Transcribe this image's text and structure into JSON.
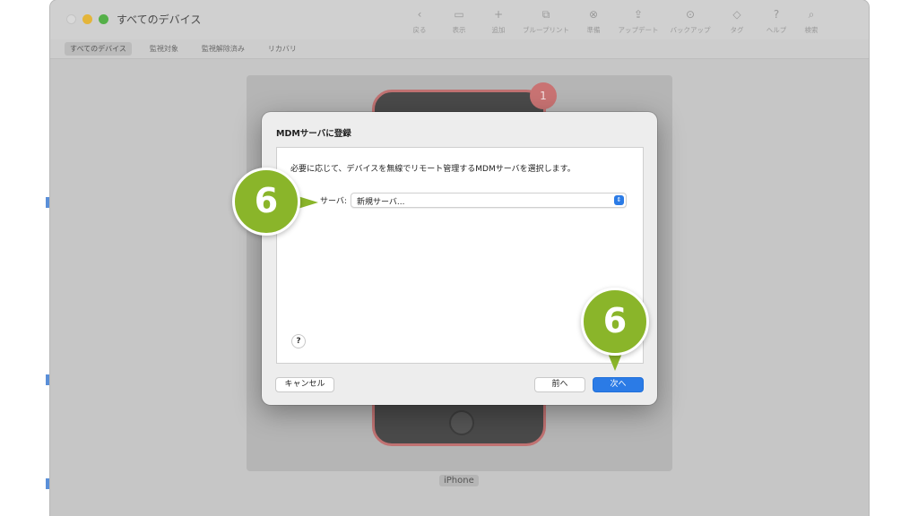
{
  "window": {
    "title": "すべてのデバイス",
    "toolbar": [
      {
        "label": "戻る",
        "icon": "chevron-left-icon",
        "glyph": "‹"
      },
      {
        "label": "表示",
        "icon": "view-icon",
        "glyph": "▭"
      },
      {
        "label": "追加",
        "icon": "plus-icon",
        "glyph": "+"
      },
      {
        "label": "ブループリント",
        "icon": "blueprint-icon",
        "glyph": "⧉"
      },
      {
        "label": "準備",
        "icon": "prepare-icon",
        "glyph": "⊗"
      },
      {
        "label": "アップデート",
        "icon": "update-icon",
        "glyph": "⇪"
      },
      {
        "label": "バックアップ",
        "icon": "backup-icon",
        "glyph": "⊙"
      },
      {
        "label": "タグ",
        "icon": "tag-icon",
        "glyph": "◇"
      },
      {
        "label": "ヘルプ",
        "icon": "help-icon",
        "glyph": "?"
      },
      {
        "label": "検索",
        "icon": "search-icon",
        "glyph": "⌕"
      }
    ],
    "tabs": [
      "すべてのデバイス",
      "監視対象",
      "監視解除済み",
      "リカバリ"
    ],
    "device_caption": "iPhone",
    "device_badge": "1"
  },
  "dialog": {
    "title": "MDMサーバに登録",
    "description": "必要に応じて、デバイスを無線でリモート管理するMDMサーバを選択します。",
    "server_label": "サーバ:",
    "server_value": "新規サーバ...",
    "help_label": "?",
    "cancel_label": "キャンセル",
    "back_label": "前へ",
    "next_label": "次へ"
  },
  "callouts": {
    "step_left": "6",
    "step_right": "6"
  },
  "colors": {
    "accent": "#2b7be6",
    "callout": "#8ab52a",
    "badge": "#c97373"
  }
}
